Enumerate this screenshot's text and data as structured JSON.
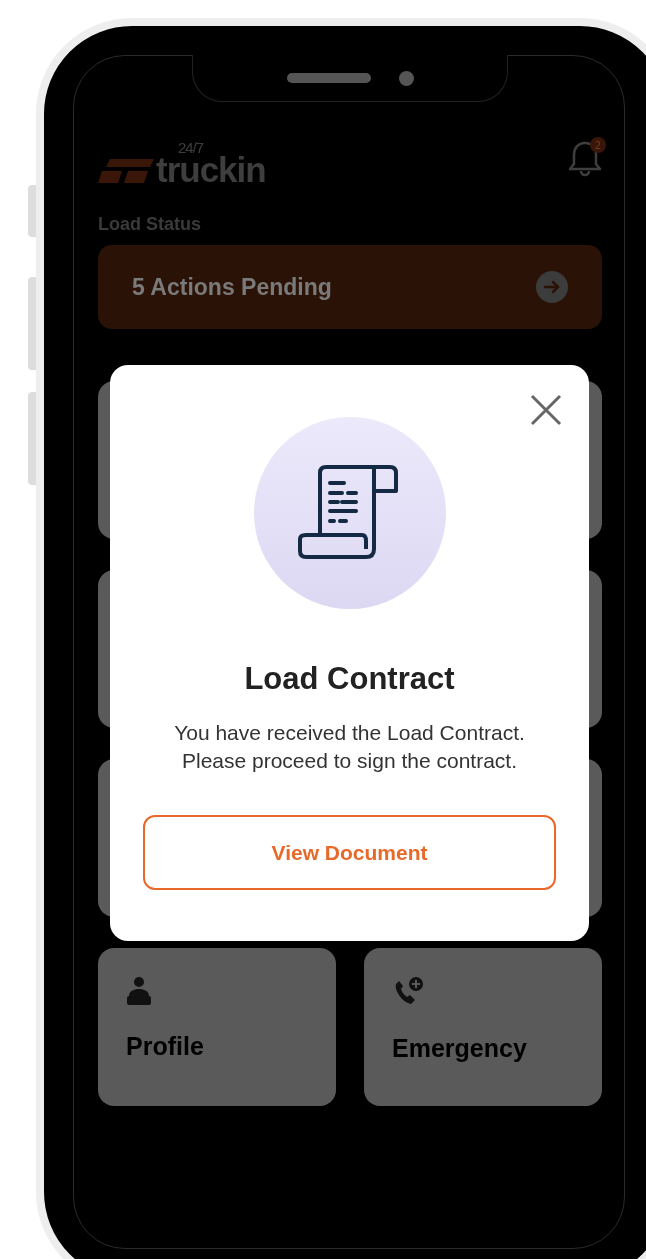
{
  "header": {
    "logo_superscript": "24/7",
    "logo_text": "truckin",
    "notification_count": "2"
  },
  "load_status": {
    "label": "Load Status",
    "pending_text": "5 Actions Pending"
  },
  "tiles": [
    {
      "kind": "covered"
    },
    {
      "kind": "covered"
    },
    {
      "kind": "covered"
    },
    {
      "kind": "covered"
    },
    {
      "kind": "covered"
    },
    {
      "kind": "covered"
    },
    {
      "kind": "profile",
      "label": "Profile"
    },
    {
      "kind": "emergency",
      "label": "Emergency"
    }
  ],
  "modal": {
    "title": "Load Contract",
    "message": "You have received the Load Contract. Please proceed to sign the contract.",
    "button": "View Document"
  }
}
